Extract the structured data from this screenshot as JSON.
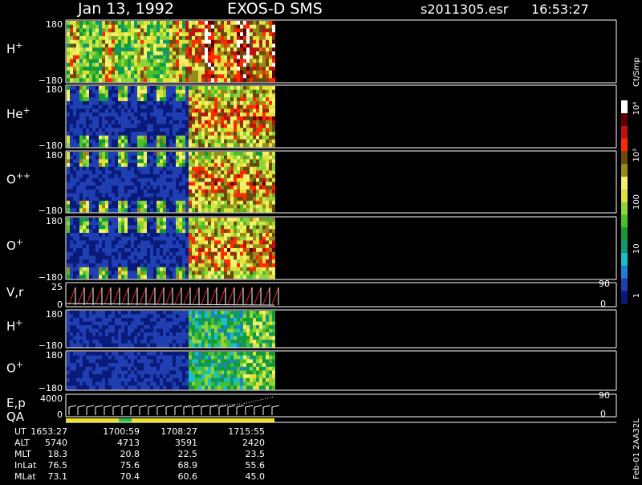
{
  "header": {
    "date": "Jan 13, 1992",
    "instrument": "EXOS-D SMS",
    "file": "s2011305.esr",
    "time": "16:53:27"
  },
  "colorbar": {
    "unit": "Ct/Smp",
    "ticks": [
      "1",
      "10",
      "100",
      "10³",
      "10⁴"
    ],
    "colors": [
      "#0a1a7a",
      "#1f3fb2",
      "#1e7fd8",
      "#19c0c8",
      "#0e9a6e",
      "#159935",
      "#49bf2a",
      "#8fd43a",
      "#dfe23b",
      "#f2f26a",
      "#9a8a1a",
      "#6b4a10",
      "#ff2a00",
      "#c01010",
      "#600000",
      "#ffffff"
    ]
  },
  "panels": [
    {
      "id": "H+",
      "label": "H",
      "sup": "+",
      "ymax": "180",
      "ymin": "−180",
      "rhs": ""
    },
    {
      "id": "He+",
      "label": "He",
      "sup": "+",
      "ymax": "180",
      "ymin": "−180",
      "rhs": ""
    },
    {
      "id": "O++",
      "label": "O",
      "sup": "++",
      "ymax": "180",
      "ymin": "−180",
      "rhs": ""
    },
    {
      "id": "O+",
      "label": "O",
      "sup": "+",
      "ymax": "180",
      "ymin": "−180",
      "rhs": ""
    },
    {
      "id": "Vr",
      "label": "V,r",
      "sup": "",
      "ymax": "25",
      "ymin": "0",
      "rhs_top": "90",
      "rhs_bottom": "0"
    },
    {
      "id": "H+2",
      "label": "H",
      "sup": "+",
      "ymax": "180",
      "ymin": "−180",
      "rhs": ""
    },
    {
      "id": "O+2",
      "label": "O",
      "sup": "+",
      "ymax": "180",
      "ymin": "−180",
      "rhs": ""
    },
    {
      "id": "Ep",
      "label": "E,p",
      "sup": "",
      "ymax": "4000",
      "ymin": "0",
      "rhs_top": "90",
      "rhs_bottom": "0"
    }
  ],
  "qa_label": "QA",
  "ephemeris": {
    "rows": [
      {
        "name": "UT",
        "values": [
          "1653:27",
          "1700:59",
          "1708:27",
          "1715:55"
        ]
      },
      {
        "name": "ALT",
        "values": [
          "5740",
          "4713",
          "3591",
          "2420"
        ]
      },
      {
        "name": "MLT",
        "values": [
          "18.3",
          "20.8",
          "22.5",
          "23.5"
        ]
      },
      {
        "name": "InLat",
        "values": [
          "76.5",
          "75.6",
          "68.9",
          "55.6"
        ]
      },
      {
        "name": "MLat",
        "values": [
          "73.1",
          "70.4",
          "60.6",
          "45.0"
        ]
      }
    ]
  },
  "side_text": "Feb-01 2AA32L",
  "chart_data": {
    "type": "heatmap",
    "title": "Jan 13, 1992  EXOS-D SMS",
    "xlabel": "UT",
    "x_ticks": [
      "1653:27",
      "1700:59",
      "1708:27",
      "1715:55"
    ],
    "panels": [
      "H+",
      "He+",
      "O++",
      "O+",
      "V,r",
      "H+",
      "O+",
      "E,p"
    ],
    "ylim_pitch": [
      -180,
      180
    ],
    "ylim_v": [
      0,
      25
    ],
    "ylim_e": [
      0,
      4000
    ],
    "colorbar_range": [
      1,
      10000
    ],
    "colorbar_scale": "log",
    "data_extends_to": "1715:55"
  }
}
